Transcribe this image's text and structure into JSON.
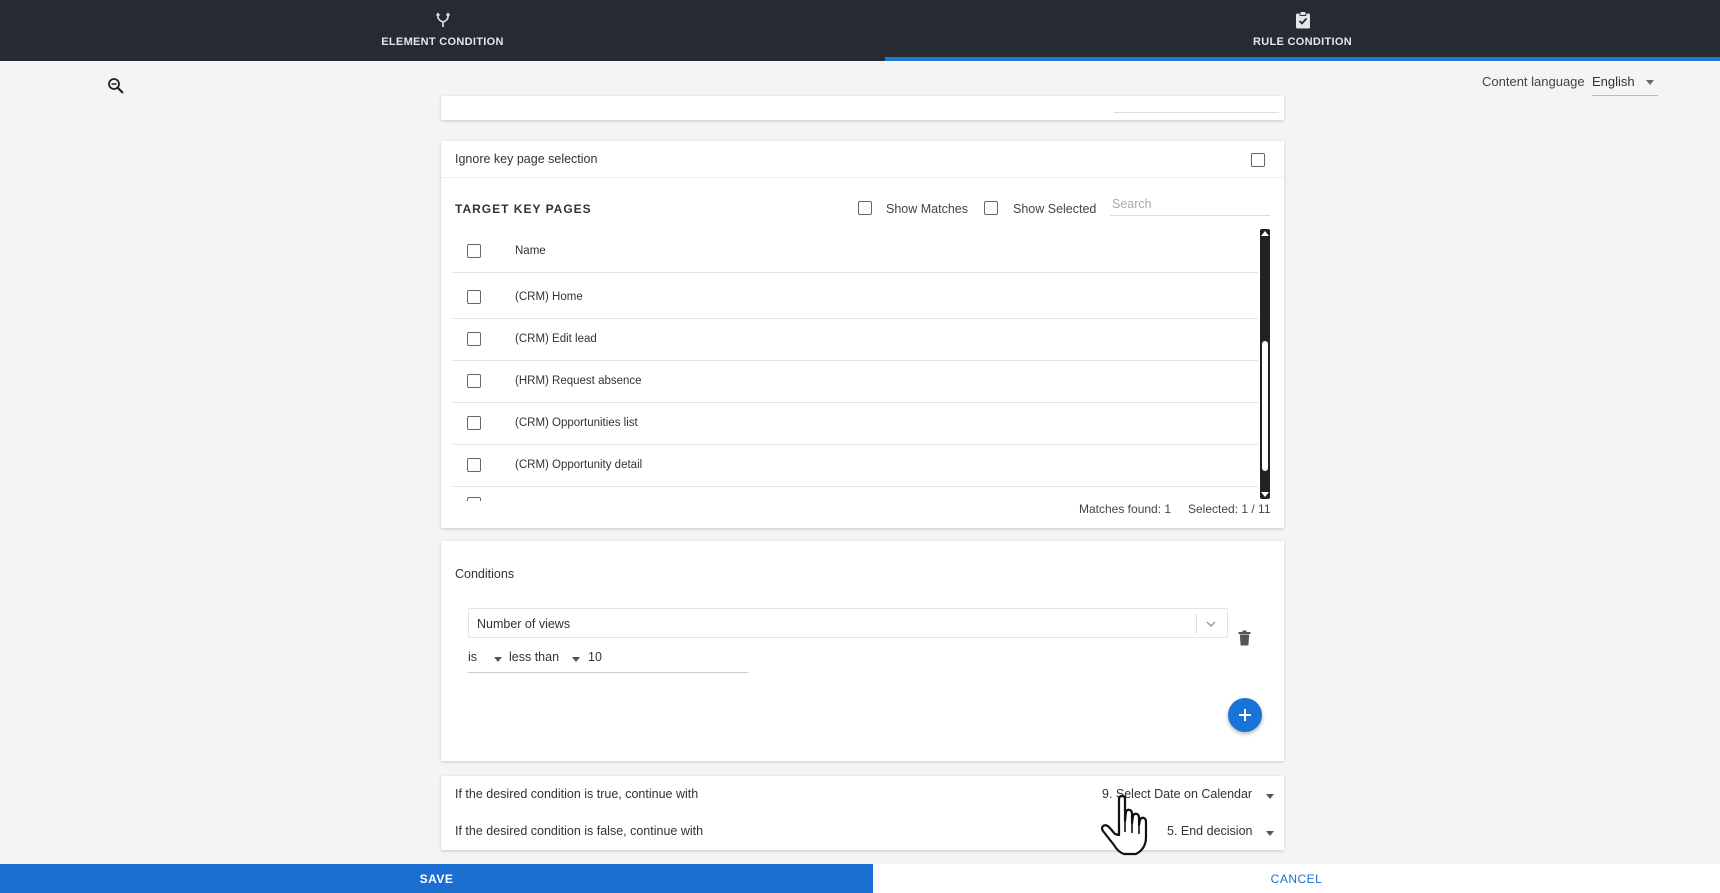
{
  "tabs": [
    {
      "label": "ELEMENT CONDITION",
      "icon": "branch-icon"
    },
    {
      "label": "RULE CONDITION",
      "icon": "clipboard-check-icon"
    }
  ],
  "active_tab": "RULE CONDITION",
  "content_language": {
    "label": "Content language",
    "value": "English"
  },
  "ignore_key_page": {
    "label": "Ignore key page selection"
  },
  "target_key_pages": {
    "title": "TARGET KEY PAGES",
    "show_matches": "Show Matches",
    "show_selected": "Show Selected",
    "search_placeholder": "Search",
    "column_name": "Name",
    "rows": [
      "(CRM) Home",
      "(CRM) Edit lead",
      "(HRM) Request absence",
      "(CRM) Opportunities list",
      "(CRM) Opportunity detail"
    ],
    "matches_found": "Matches found: 1",
    "selected": "Selected: 1 / 11"
  },
  "conditions": {
    "title": "Conditions",
    "metric": "Number of views",
    "operator_is": "is",
    "comparator": "less than",
    "value": "10"
  },
  "continuation": {
    "true_label": "If the desired condition is true, continue with",
    "true_value": "9. Select Date on Calendar",
    "false_label": "If the desired condition is false, continue with",
    "false_value": "5. End decision"
  },
  "actions": {
    "save": "SAVE",
    "cancel": "CANCEL"
  },
  "colors": {
    "topbar": "#252a33",
    "accent": "#1a6fd0"
  }
}
